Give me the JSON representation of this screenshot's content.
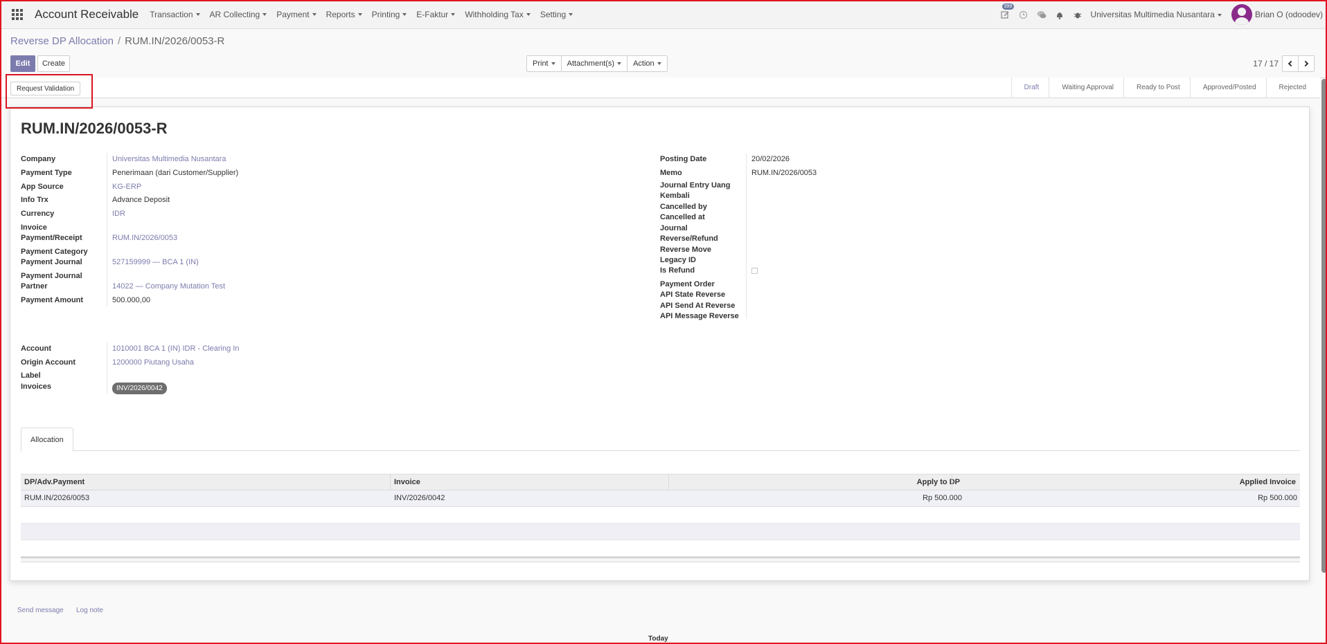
{
  "navbar": {
    "app_title": "Account Receivable",
    "menu": [
      "Transaction",
      "AR Collecting",
      "Payment",
      "Reports",
      "Printing",
      "E-Faktur",
      "Withholding Tax",
      "Setting"
    ],
    "activity_count": "399",
    "company": "Universitas Multimedia Nusantara",
    "user": "Brian O (odoodev)"
  },
  "breadcrumb": {
    "parent": "Reverse DP Allocation",
    "current": "RUM.IN/2026/0053-R"
  },
  "buttons": {
    "edit": "Edit",
    "create": "Create",
    "print": "Print",
    "attachments": "Attachment(s)",
    "action": "Action",
    "request_validation": "Request Validation"
  },
  "pager": {
    "value": "17 / 17"
  },
  "stages": [
    "Draft",
    "Waiting Approval",
    "Ready to Post",
    "Approved/Posted",
    "Rejected"
  ],
  "record": {
    "title": "RUM.IN/2026/0053-R",
    "left_fields": [
      {
        "label": "Company",
        "value": "Universitas Multimedia Nusantara",
        "link": true
      },
      {
        "label": "Payment Type",
        "value": "Penerimaan (dari Customer/Supplier)",
        "link": false
      },
      {
        "label": "App Source",
        "value": "KG-ERP",
        "link": true
      },
      {
        "label": "Info Trx",
        "value": "Advance Deposit",
        "link": false
      },
      {
        "label": "Currency",
        "value": "IDR",
        "link": true
      },
      {
        "label": "Invoice Payment/Receipt",
        "value": "RUM.IN/2026/0053",
        "link": true
      },
      {
        "label": "Payment Category",
        "value": "",
        "link": false
      },
      {
        "label": "Payment Journal",
        "value": "527159999 — BCA 1 (IN)",
        "link": true
      },
      {
        "label": "Payment Journal Partner",
        "value": "14022 — Company Mutation Test",
        "link": true
      },
      {
        "label": "Payment Amount",
        "value": "500.000,00",
        "link": false
      }
    ],
    "right_fields": [
      {
        "label": "Posting Date",
        "value": "20/02/2026"
      },
      {
        "label": "Memo",
        "value": "RUM.IN/2026/0053"
      },
      {
        "label": "Journal Entry Uang Kembali",
        "value": ""
      },
      {
        "label": "Cancelled by",
        "value": ""
      },
      {
        "label": "Cancelled at",
        "value": ""
      },
      {
        "label": "Journal Reverse/Refund",
        "value": ""
      },
      {
        "label": "Reverse Move",
        "value": ""
      },
      {
        "label": "Legacy ID",
        "value": ""
      },
      {
        "label": "Is Refund",
        "value": ""
      },
      {
        "label": "Payment Order",
        "value": ""
      },
      {
        "label": "API State Reverse",
        "value": ""
      },
      {
        "label": "API Send At Reverse",
        "value": ""
      },
      {
        "label": "API Message Reverse",
        "value": ""
      }
    ],
    "account_fields": [
      {
        "label": "Account",
        "value": "1010001 BCA 1 (IN) IDR - Clearing In"
      },
      {
        "label": "Origin Account",
        "value": "1200000 Piutang Usaha"
      },
      {
        "label": "Label",
        "value": ""
      },
      {
        "label": "Invoices",
        "value": "INV/2026/0042"
      }
    ]
  },
  "tabs": [
    "Allocation"
  ],
  "allocation_table": {
    "columns": [
      "DP/Adv.Payment",
      "Invoice",
      "Apply to DP",
      "Applied Invoice"
    ],
    "rows": [
      [
        "RUM.IN/2026/0053",
        "INV/2026/0042",
        "Rp 500.000",
        "Rp 500.000"
      ]
    ]
  },
  "chatter": {
    "send_message": "Send message",
    "log_note": "Log note",
    "today": "Today"
  }
}
